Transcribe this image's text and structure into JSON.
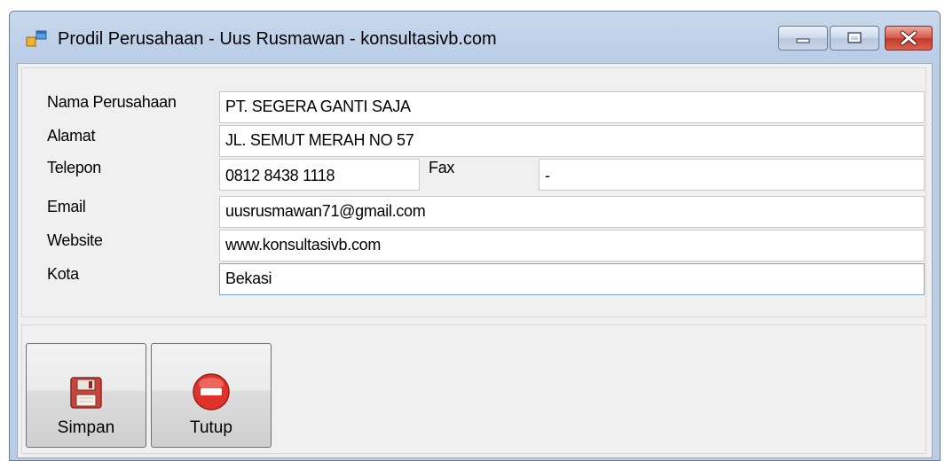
{
  "window": {
    "title": "Prodil Perusahaan - Uus Rusmawan - konsultasivb.com",
    "app_icon": "window-app-icon",
    "controls": [
      "minimize-icon",
      "maximize-icon",
      "close-icon"
    ]
  },
  "form": {
    "nama_label": "Nama Perusahaan",
    "nama_value": "PT. SEGERA GANTI SAJA",
    "alamat_label": "Alamat",
    "alamat_value": "JL. SEMUT MERAH NO 57",
    "telepon_label": "Telepon",
    "telepon_value": "0812 8438 1118",
    "fax_label": "Fax",
    "fax_value": "-",
    "email_label": "Email",
    "email_value": "uusrusmawan71@gmail.com",
    "website_label": "Website",
    "website_value": "www.konsultasivb.com",
    "kota_label": "Kota",
    "kota_value": "Bekasi"
  },
  "buttons": {
    "simpan_label": "Simpan",
    "simpan_icon": "floppy-disk-icon",
    "tutup_label": "Tutup",
    "tutup_icon": "stop-icon"
  },
  "colors": {
    "titlebar": "#bdd0e8",
    "close_button": "#c9463a",
    "stop_icon": "#e0322a",
    "floppy_icon": "#c8453d"
  }
}
